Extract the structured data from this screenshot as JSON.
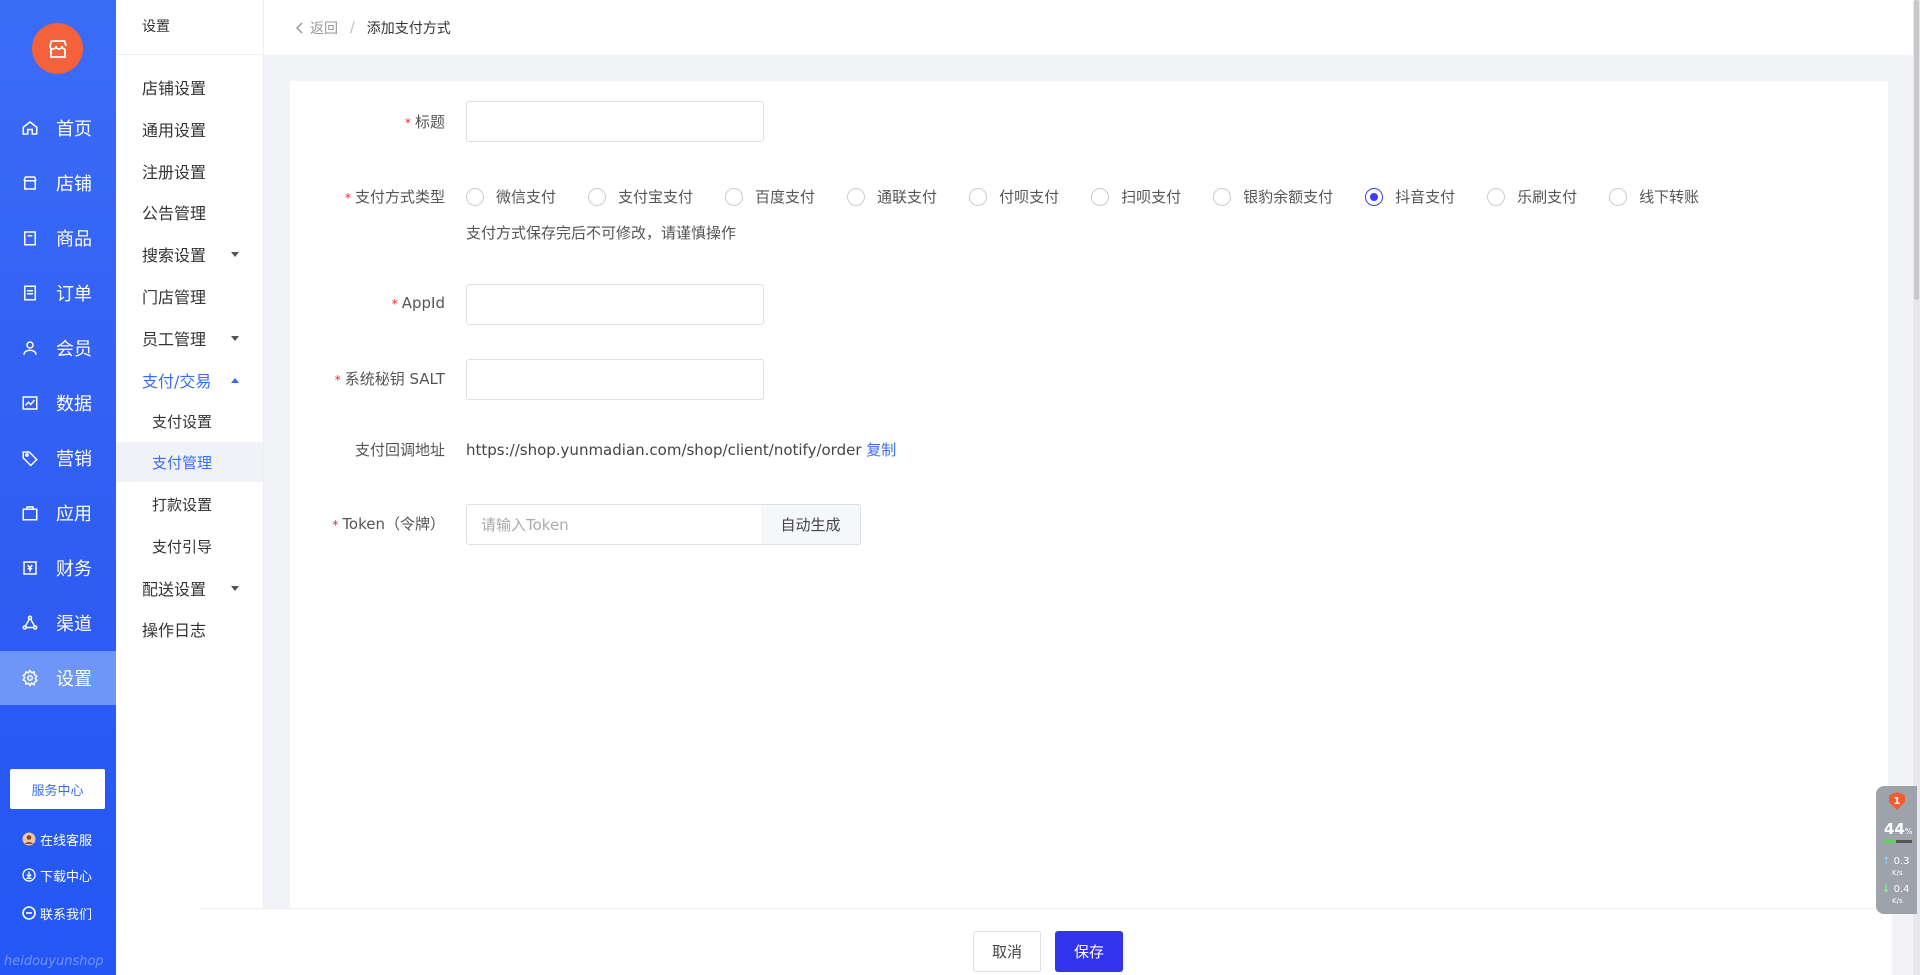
{
  "main_nav": {
    "items": [
      {
        "label": "首页",
        "icon": "home-icon"
      },
      {
        "label": "店铺",
        "icon": "store-icon"
      },
      {
        "label": "商品",
        "icon": "goods-icon"
      },
      {
        "label": "订单",
        "icon": "order-icon"
      },
      {
        "label": "会员",
        "icon": "member-icon"
      },
      {
        "label": "数据",
        "icon": "chart-icon"
      },
      {
        "label": "营销",
        "icon": "tag-icon"
      },
      {
        "label": "应用",
        "icon": "app-icon"
      },
      {
        "label": "财务",
        "icon": "finance-icon"
      },
      {
        "label": "渠道",
        "icon": "channel-icon"
      },
      {
        "label": "设置",
        "icon": "gear-icon"
      }
    ],
    "active_index": 10,
    "service_center": "服务中心",
    "online_service": "在线客服",
    "download_center": "下载中心",
    "contact_us": "联系我们",
    "watermark": "heidouyunshop"
  },
  "sub_nav": {
    "title": "设置",
    "items": [
      {
        "label": "店铺设置"
      },
      {
        "label": "通用设置"
      },
      {
        "label": "注册设置"
      },
      {
        "label": "公告管理"
      },
      {
        "label": "搜索设置"
      },
      {
        "label": "门店管理"
      },
      {
        "label": "员工管理"
      },
      {
        "label": "支付/交易"
      },
      {
        "label": "配送设置"
      },
      {
        "label": "操作日志"
      }
    ],
    "children": [
      {
        "label": "支付设置"
      },
      {
        "label": "支付管理"
      },
      {
        "label": "打款设置"
      },
      {
        "label": "支付引导"
      }
    ]
  },
  "breadcrumb": {
    "back": "返回",
    "separator": "/",
    "current": "添加支付方式"
  },
  "form": {
    "title_label": "标题",
    "title_value": "",
    "pay_type_label": "支付方式类型",
    "pay_types": [
      "微信支付",
      "支付宝支付",
      "百度支付",
      "通联支付",
      "付呗支付",
      "扫呗支付",
      "银豹余额支付",
      "抖音支付",
      "乐刷支付",
      "线下转账"
    ],
    "pay_type_selected": "抖音支付",
    "pay_type_hint": "支付方式保存完后不可修改，请谨慎操作",
    "appid_label": "AppId",
    "appid_value": "",
    "salt_label": "系统秘钥 SALT",
    "salt_value": "",
    "callback_label": "支付回调地址",
    "callback_url": "https://shop.yunmadian.com/shop/client/notify/order",
    "copy_label": "复制",
    "token_label": "Token（令牌）",
    "token_placeholder": "请输入Token",
    "token_value": "",
    "auto_generate": "自动生成",
    "required_mark": "*"
  },
  "footer": {
    "cancel": "取消",
    "save": "保存"
  },
  "widget": {
    "badge": "1",
    "cpu": "44",
    "cpu_unit": "%",
    "up_speed": "0.3",
    "down_speed": "0.4",
    "speed_unit": "K/s"
  }
}
